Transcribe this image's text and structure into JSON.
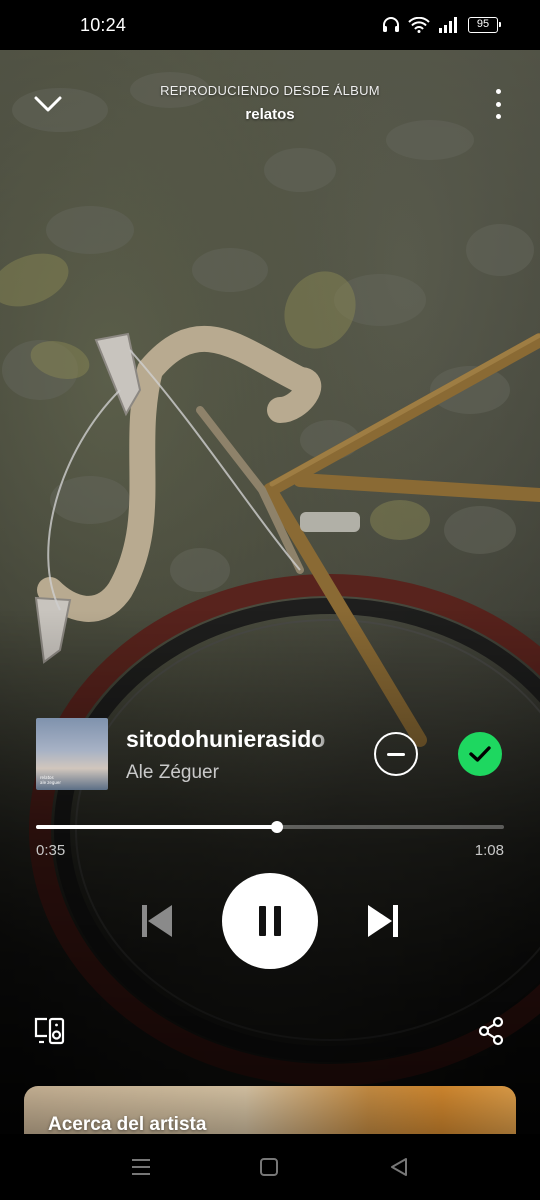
{
  "status_bar": {
    "time": "10:24",
    "battery": "95",
    "icons": [
      "headphones-icon",
      "wifi-icon",
      "signal-icon",
      "battery-icon"
    ]
  },
  "header": {
    "context_label": "REPRODUCIENDO DESDE ÁLBUM",
    "album_name": "relatos",
    "icons": [
      "chevron-down-icon",
      "more-vertical-icon"
    ]
  },
  "track": {
    "title": "sitodohunierasido",
    "artist": "Ale Zéguer",
    "cover_text": "relatos\nale zeguer",
    "liked": true
  },
  "playback": {
    "elapsed": "0:35",
    "duration": "1:08",
    "progress_fraction": 0.515,
    "is_playing": true
  },
  "controls": {
    "icons": [
      "skip-previous-icon",
      "pause-icon",
      "skip-next-icon",
      "devices-icon",
      "share-icon",
      "minus-circle-icon",
      "check-circle-icon"
    ]
  },
  "artist_card": {
    "title": "Acerca del artista"
  },
  "nav_bar": {
    "icons": [
      "menu-icon",
      "home-icon",
      "back-icon"
    ]
  },
  "colors": {
    "accent_green": "#1ed760",
    "background": "#000000",
    "text_secondary": "#c8c8c8"
  }
}
